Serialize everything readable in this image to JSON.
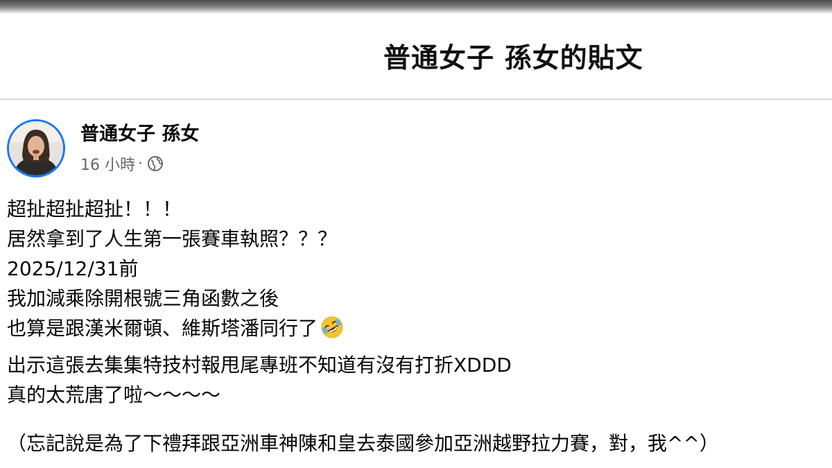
{
  "header": {
    "title": "普通女子 孫女的貼文"
  },
  "post": {
    "author": "普通女子 孫女",
    "time": "16 小時",
    "separator": "·",
    "privacy_icon": "globe-icon",
    "lines": [
      "超扯超扯超扯！！！",
      "居然拿到了人生第一張賽車執照？？？",
      "2025/12/31前",
      "我加減乘除開根號三角函數之後",
      "也算是跟漢米爾頓、維斯塔潘同行了"
    ],
    "emoji": "rolling-on-floor-laughing-emoji",
    "lines2": [
      "出示這張去集集特技村報甩尾專班不知道有沒有打折XDDD",
      "真的太荒唐了啦～～～～"
    ],
    "note": "（忘記說是為了下禮拜跟亞洲車神陳和皇去泰國參加亞洲越野拉力賽，對，我^^）"
  },
  "colors": {
    "accent": "#1877f2",
    "meta_text": "#65676b",
    "text": "#050505",
    "divider": "#d6d6d6"
  }
}
